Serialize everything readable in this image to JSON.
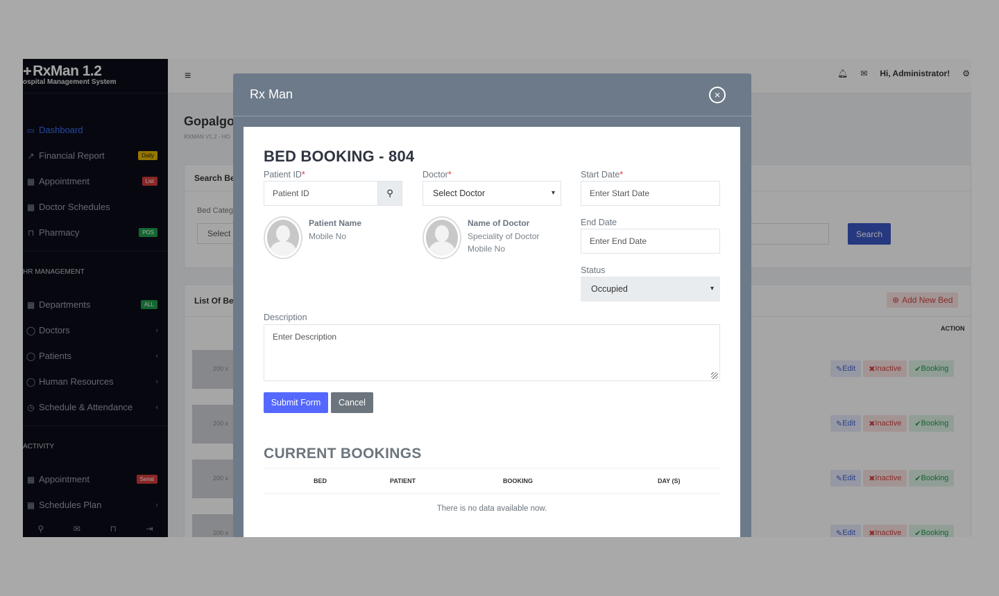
{
  "brand": {
    "name": "RxMan 1.2",
    "subtitle": "ospital Management System"
  },
  "sidebar": {
    "items": [
      {
        "label": "Dashboard",
        "icon": "monitor-icon",
        "badge": "",
        "active": true
      },
      {
        "label": "Financial Report",
        "icon": "chart-icon",
        "badge": "Daily"
      },
      {
        "label": "Appointment",
        "icon": "calendar-icon",
        "badge": "List"
      },
      {
        "label": "Doctor Schedules",
        "icon": "calendar-icon",
        "badge": ""
      },
      {
        "label": "Pharmacy",
        "icon": "cart-icon",
        "badge": "POS"
      }
    ],
    "hr_heading": "HR MANAGEMENT",
    "hr_items": [
      {
        "label": "Departments",
        "badge": "ALL"
      },
      {
        "label": "Doctors"
      },
      {
        "label": "Patients"
      },
      {
        "label": "Human Resources"
      },
      {
        "label": "Schedule & Attendance"
      }
    ],
    "activity_heading": "ACTIVITY",
    "activity_items": [
      {
        "label": "Appointment",
        "badge": "Serial"
      },
      {
        "label": "Schedules Plan"
      }
    ]
  },
  "topbar": {
    "greeting": "Hi, Administrator!"
  },
  "background": {
    "page_title": "Gopalgo",
    "page_subtitle": "RXMAN V1.2 - HO",
    "search_card_title": "Search Be",
    "bed_category_label": "Bed Categ",
    "select_label": "Select",
    "search_button": "Search",
    "list_card_title": "List Of Be",
    "add_new_bed": "Add New Bed",
    "action_header": "ACTION",
    "row_placeholder": "200 x",
    "row_actions": {
      "edit": "Edit",
      "inactive": "Inactive",
      "booking": "Booking"
    }
  },
  "modal": {
    "title": "Rx Man",
    "heading": "BED BOOKING - 804",
    "patient_id_label": "Patient ID",
    "patient_id_placeholder": "Patient ID",
    "doctor_label": "Doctor",
    "doctor_select_value": "Select Doctor",
    "start_date_label": "Start Date",
    "start_date_placeholder": "Enter Start Date",
    "patient_name": "Patient Name",
    "patient_mobile": "Mobile No",
    "doctor_name": "Name of Doctor",
    "doctor_speciality": "Speciality of Doctor",
    "doctor_mobile": "Mobile No",
    "end_date_label": "End Date",
    "end_date_placeholder": "Enter End Date",
    "status_label": "Status",
    "status_value": "Occupied",
    "description_label": "Description",
    "description_placeholder": "Enter Description",
    "submit_button": "Submit Form",
    "cancel_button": "Cancel",
    "current_bookings_title": "CURRENT BOOKINGS",
    "table_headers": [
      "BED",
      "PATIENT",
      "BOOKING",
      "DAY (S)"
    ],
    "empty_message": "There is no data available now."
  }
}
